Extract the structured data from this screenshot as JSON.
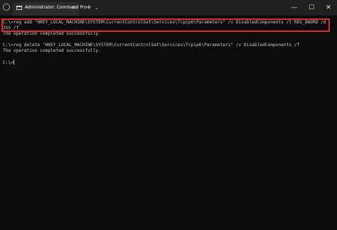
{
  "window": {
    "tab_title": "Administrator: Command Pro",
    "tab_close": "✕",
    "new_tab": "+",
    "dropdown": "⌄",
    "minimize": "—",
    "maximize": "☐",
    "close": "✕"
  },
  "console": {
    "lines": [
      "C:\\>reg add \"HKEY_LOCAL_MACHINE\\SYSTEM\\CurrentControlSet\\Services\\Tcpip6\\Parameters\" /v DisabledComponents /t REG_DWORD /d",
      "255 /f",
      "The operation completed successfully.",
      "",
      "C:\\>reg delete \"HKEY_LOCAL_MACHINE\\SYSTEM\\CurrentControlSet\\Services\\Tcpip6\\Parameters\" /v DisabledComponents /f",
      "The operation completed successfully.",
      "",
      "C:\\>"
    ]
  },
  "colors": {
    "background": "#0c0c0c",
    "titlebar": "#202020",
    "text": "#cccccc",
    "highlight": "#e3262a"
  }
}
